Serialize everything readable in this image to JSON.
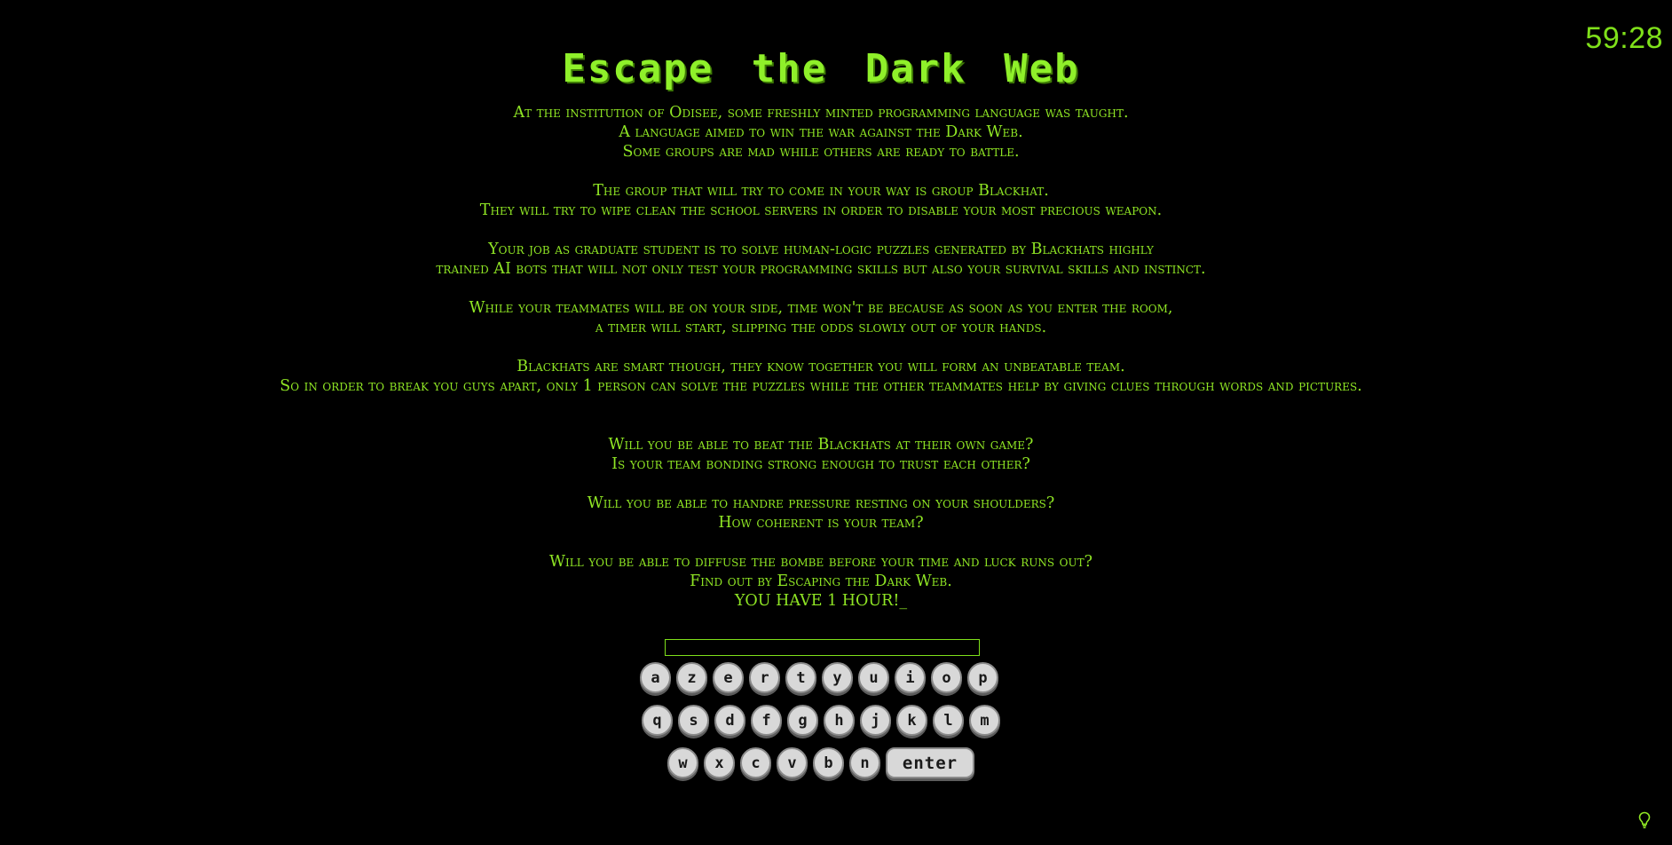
{
  "timer": {
    "text": "59:28"
  },
  "title": "Escape the Dark Web",
  "story": {
    "p1": [
      "At the institution of Odisee, some freshly minted programming language was taught.",
      "A language aimed to win the war against the Dark Web.",
      "Some groups are mad while others are ready to battle."
    ],
    "p2": [
      "The group that will try to come in your way is group Blackhat.",
      "They will try to wipe clean the school servers in order to disable your most precious weapon."
    ],
    "p3": [
      "Your job as graduate student is to solve human-logic puzzles generated by Blackhats highly",
      "trained AI bots that will not only test your programming skills but also your survival skills and instinct."
    ],
    "p4": [
      "While your teammates will be on your side, time won't be because as soon as you enter the room,",
      "a timer will start, slipping the odds slowly out of your hands."
    ],
    "p5": [
      "Blackhats are smart though, they know together you will form an unbeatable team.",
      "So in order to break you guys apart, only 1 person can solve the puzzles while the other teammates help by giving clues through words and pictures."
    ],
    "p6": [
      "Will you be able to beat the Blackhats at their own game?",
      "Is your team bonding strong enough to trust each other?"
    ],
    "p7": [
      "Will you be able to handre pressure resting on your shoulders?",
      "How coherent is your team?"
    ],
    "p8": [
      "Will you be able to diffuse the bombe before your time and luck runs out?",
      "Find out by Escaping the Dark Web.",
      "YOU HAVE 1 HOUR!_"
    ]
  },
  "input": {
    "value": ""
  },
  "keyboard": {
    "row1": [
      "a",
      "z",
      "e",
      "r",
      "t",
      "y",
      "u",
      "i",
      "o",
      "p"
    ],
    "row2": [
      "q",
      "s",
      "d",
      "f",
      "g",
      "h",
      "j",
      "k",
      "l",
      "m"
    ],
    "row3": [
      "w",
      "x",
      "c",
      "v",
      "b",
      "n"
    ],
    "enter_label": "enter"
  },
  "hint": {
    "icon": "lightbulb-icon"
  },
  "colors": {
    "background": "#000000",
    "text": "#8fe524",
    "key": "#d8d8d8"
  }
}
